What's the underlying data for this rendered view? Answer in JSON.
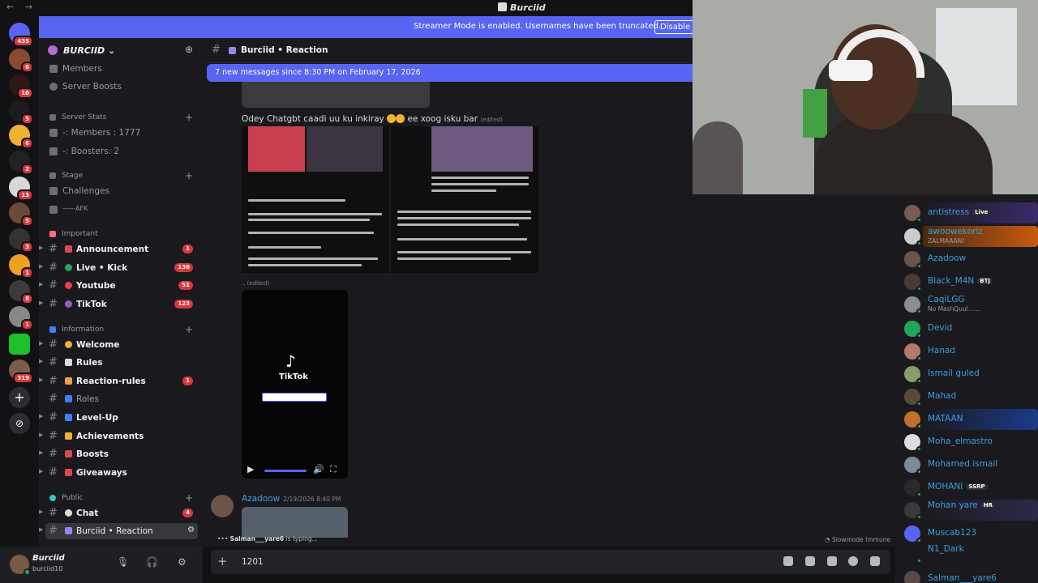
{
  "titlebar": {
    "title": "Burciid",
    "back": "←",
    "forward": "→"
  },
  "rail": {
    "badges": [
      "435",
      "6",
      "10",
      "5",
      "6",
      "2",
      "13",
      "5",
      "3",
      "1",
      "8",
      "1",
      "319"
    ],
    "add_label": "+",
    "discover_label": "⊘"
  },
  "banner": {
    "text": "Streamer Mode is enabled. Usernames have been truncated.",
    "button": "Disable"
  },
  "guild": {
    "name": "BURCIID",
    "caret": "⌄"
  },
  "sidebar": {
    "top_items": [
      {
        "label": "Members"
      },
      {
        "label": "Server Boosts"
      }
    ],
    "server_stats": {
      "category": "Server Stats",
      "items": [
        "-: Members : 1777",
        "-: Boosters: 2"
      ]
    },
    "stage": {
      "category": "Stage",
      "items": [
        "Challenges",
        "——AFK"
      ]
    },
    "important": {
      "category": "Important",
      "channels": [
        {
          "label": "Announcement",
          "count": "1"
        },
        {
          "label": "Live • Kick",
          "count": "136"
        },
        {
          "label": "Youtube",
          "count": "51"
        },
        {
          "label": "TikTok",
          "count": "123"
        }
      ]
    },
    "information": {
      "category": "Information",
      "channels": [
        {
          "label": "Welcome",
          "count": ""
        },
        {
          "label": "Rules",
          "count": ""
        },
        {
          "label": "Reaction-rules",
          "count": "1"
        },
        {
          "label": "Roles",
          "count": ""
        },
        {
          "label": "Level-Up",
          "count": ""
        },
        {
          "label": "Achievements",
          "count": ""
        },
        {
          "label": "Boosts",
          "count": ""
        },
        {
          "label": "Giveaways",
          "count": ""
        }
      ]
    },
    "public": {
      "category": "Public",
      "channels": [
        {
          "label": "Chat",
          "count": "4"
        },
        {
          "label": "Burciid • Reaction",
          "count": ""
        }
      ]
    }
  },
  "user": {
    "name": "Burciid",
    "status": "burciid10"
  },
  "chat": {
    "channel": "Burciid • Reaction",
    "new_messages": "7 new messages since 8:30 PM on February 17, 2026",
    "message1": {
      "text": "Odey Chatgbt caadi uu ku inkiray",
      "after": "ee xoog isku bar",
      "edited": "(edited)"
    },
    "dots_edited": ".. (edited)",
    "video": {
      "title": "TikTok"
    },
    "message2": {
      "author": "Azadoow",
      "time": "2/19/2026 8:40 PM"
    },
    "typing": {
      "user": "Salman___yare6",
      "suffix": " is typing..."
    },
    "slowmode": "Slowmode Immune",
    "composer_value": "1201"
  },
  "members": [
    {
      "name": "antistress",
      "tag": "Live",
      "sub": ""
    },
    {
      "name": "awoowekoriz",
      "tag": "",
      "sub": "ZALMAAAN!"
    },
    {
      "name": "Azadoow",
      "tag": "",
      "sub": ""
    },
    {
      "name": "Black_M4N",
      "tag": "BTJ",
      "sub": ""
    },
    {
      "name": "CaqiLGG",
      "tag": "",
      "sub": "No MashQuul......"
    },
    {
      "name": "Devid",
      "tag": "",
      "sub": ""
    },
    {
      "name": "Hanad",
      "tag": "",
      "sub": ""
    },
    {
      "name": "Ismail guled",
      "tag": "",
      "sub": ""
    },
    {
      "name": "Mahad",
      "tag": "",
      "sub": ""
    },
    {
      "name": "MATAAN",
      "tag": "",
      "sub": ""
    },
    {
      "name": "Moha_elmastro",
      "tag": "",
      "sub": ""
    },
    {
      "name": "Mohamed ismail",
      "tag": "",
      "sub": ""
    },
    {
      "name": "MOHANI",
      "tag": "SSRP",
      "sub": ""
    },
    {
      "name": "Mohan yare",
      "tag": "HR",
      "sub": ""
    },
    {
      "name": "Muscab123",
      "tag": "",
      "sub": ""
    },
    {
      "name": "N1_Dark",
      "tag": "",
      "sub": ""
    },
    {
      "name": "Salman___yare6",
      "tag": "",
      "sub": ""
    }
  ]
}
